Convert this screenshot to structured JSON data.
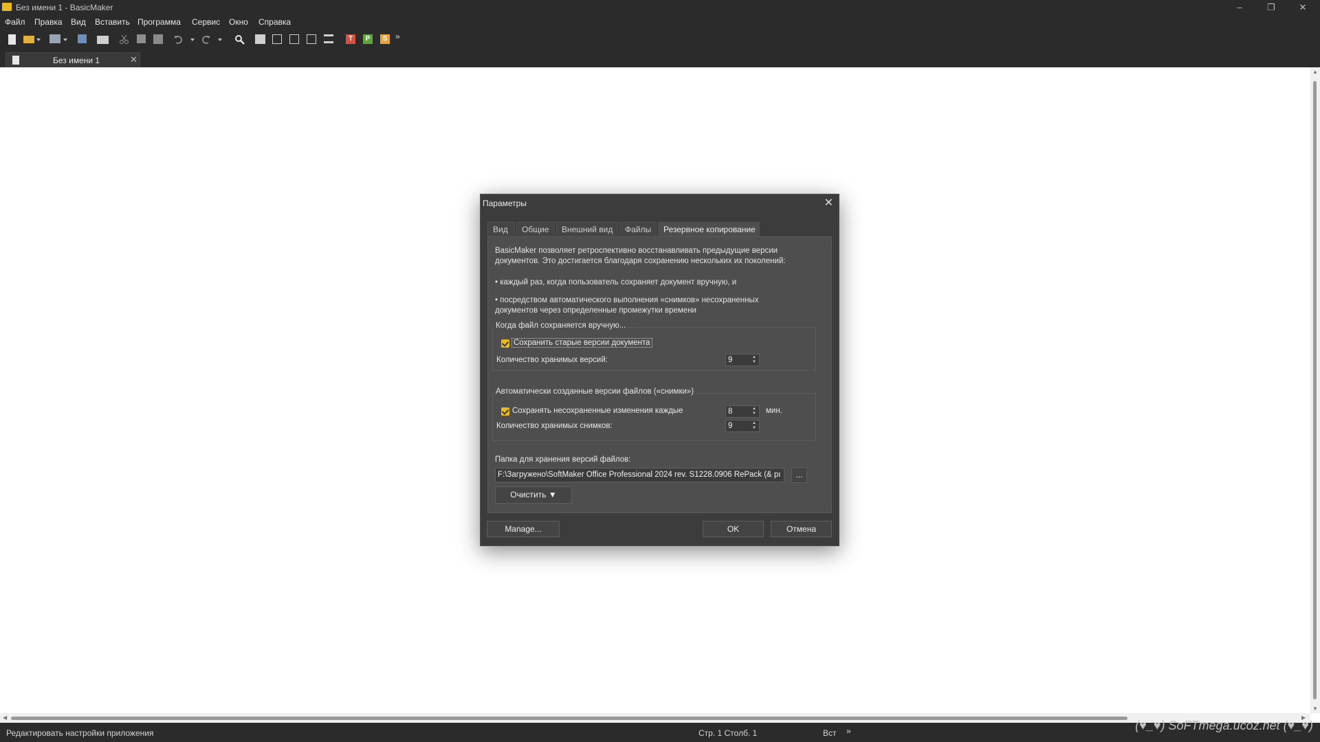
{
  "window": {
    "title": "Без имени 1 - BasicMaker",
    "minimize": "–",
    "restore": "❐",
    "close": "✕"
  },
  "menu": [
    "Файл",
    "Правка",
    "Вид",
    "Вставить",
    "Программа",
    "Сервис",
    "Окно",
    "Справка"
  ],
  "document_tab": {
    "label": "Без имени 1",
    "close": "✕"
  },
  "toolbar": {
    "more": "»",
    "letters": {
      "textmaker": "T",
      "planmaker": "P",
      "presentations": "S"
    }
  },
  "dialog": {
    "title": "Параметры",
    "close": "✕",
    "tabs": [
      "Вид",
      "Общие",
      "Внешний вид",
      "Файлы",
      "Резервное копирование"
    ],
    "active_tab": "Резервное копирование",
    "intro_line1": "BasicMaker позволяет ретроспективно восстанавливать предыдущие версии",
    "intro_line2": "документов. Это достигается благодаря сохранению нескольких их поколений:",
    "bullet1": "• каждый раз, когда пользователь сохраняет документ вручную, и",
    "bullet2_line1": "• посредством автоматического выполнения «снимков» несохраненных",
    "bullet2_line2": "документов через определенные промежутки времени",
    "manual_group": {
      "label": "Когда файл сохраняется вручную...",
      "checkbox_label": "Сохранить старые версии документа",
      "checked": true,
      "versions_label": "Количество хранимых версий:",
      "versions_value": "9"
    },
    "auto_group": {
      "label": "Автоматически созданные версии файлов («снимки»)",
      "checkbox_label": "Сохранять несохраненные изменения каждые",
      "checked": true,
      "interval_value": "8",
      "interval_unit": "мин.",
      "snapshots_label": "Количество хранимых снимков:",
      "snapshots_value": "9"
    },
    "folder_label": "Папка для хранения версий файлов:",
    "folder_path": "F:\\Загружено\\SoftMaker Office Professional 2024 rev. S1228.0906 RePack (& pı",
    "browse_button": "...",
    "clear_button": "Очистить ▼",
    "manage_button": "Manage...",
    "ok_button": "OK",
    "cancel_button": "Отмена"
  },
  "statusbar": {
    "hint": "Редактировать настройки приложения",
    "position": "Стр. 1 Столб. 1",
    "mode": "Вст",
    "more": "»"
  },
  "watermark": "(♥_♥) SoFTmega.ucoz.net (♥_♥)",
  "colors": {
    "chrome": "#2b2b2b",
    "dialog": "#3c3c3c",
    "panel": "#4e4e4e",
    "accent": "#e8b923"
  }
}
